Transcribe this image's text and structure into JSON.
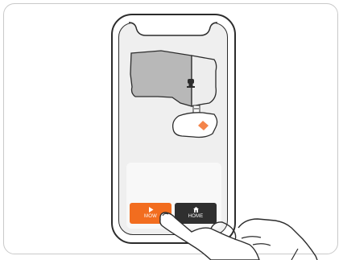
{
  "controls": {
    "mow_label": "MOW",
    "home_label": "HOME"
  },
  "icons": {
    "mow": "play-icon",
    "home": "home-icon",
    "robot": "robot-mower-icon",
    "hand": "hand-icon"
  },
  "colors": {
    "accent": "#f26d1f",
    "home_button": "#2f2f2f",
    "mapped_zone": "#b8b8b8",
    "unmapped_zone": "#e9e9e9",
    "outline": "#2c2c2c"
  }
}
